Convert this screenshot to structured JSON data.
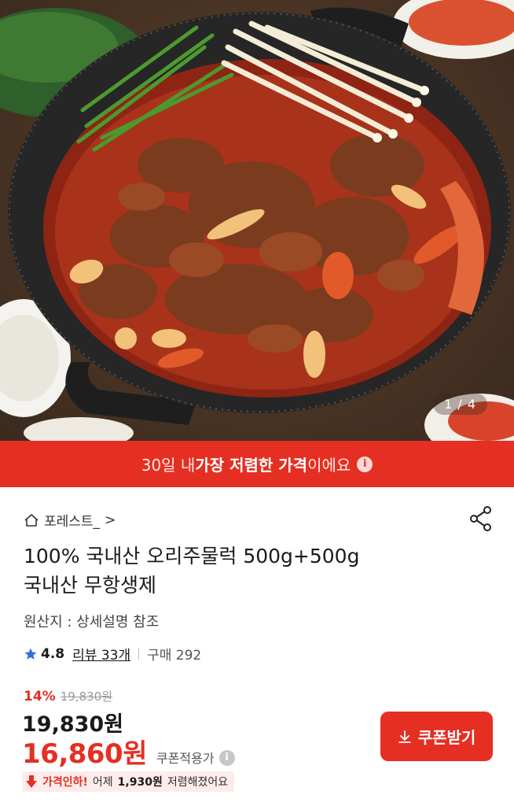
{
  "hero": {
    "pager": "1 / 4",
    "icon": "product-photo"
  },
  "banner": {
    "prefix": "30일 내 ",
    "highlight": "가장 저렴한 가격",
    "suffix": "이에요",
    "icon": "info-icon"
  },
  "store": {
    "name": "포레스트_",
    "chevron": ">",
    "icon": "home-icon"
  },
  "share": {
    "icon": "share-icon"
  },
  "product": {
    "title_line1": "100% 국내산 오리주물럭 500g+500g",
    "title_line2": "국내산 무항생제",
    "origin": "원산지 : 상세설명 참조"
  },
  "rating": {
    "score": "4.8",
    "reviews": "리뷰 33개",
    "purchases": "구매 292",
    "icon": "star-icon"
  },
  "price": {
    "discount_pct": "14%",
    "original": "19,830원",
    "current": "19,830원",
    "coupon_price": "16,860원",
    "coupon_tag": "쿠폰적용가",
    "coupon_help": "i"
  },
  "price_drop": {
    "label": "가격인하!",
    "text_before": "어제",
    "amount": "1,930원",
    "text_after": "저렴해졌어요",
    "icon": "arrow-down-icon"
  },
  "coupon_button": {
    "label": "쿠폰받기",
    "icon": "download-icon"
  },
  "colors": {
    "accent": "#e52f22",
    "text": "#1a1a1a"
  }
}
